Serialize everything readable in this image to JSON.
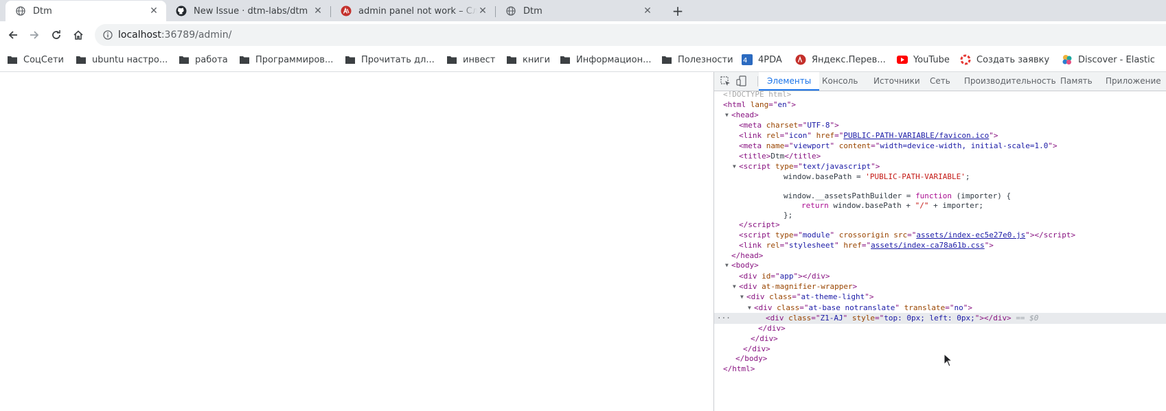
{
  "tabs": [
    {
      "title": "Dtm",
      "icon": "globe-icon",
      "active": true
    },
    {
      "title": "New Issue · dtm-labs/dtm",
      "icon": "github-icon",
      "active": false
    },
    {
      "title": "admin panel not work – Сл",
      "icon": "app-red-icon",
      "active": false
    },
    {
      "title": "Dtm",
      "icon": "globe-icon",
      "active": false
    }
  ],
  "toolbar": {
    "url_host": "localhost",
    "url_rest": ":36789/admin/"
  },
  "bookmarks": [
    {
      "label": "СоцСети",
      "icon": "folder-icon"
    },
    {
      "label": "ubuntu настро...",
      "icon": "folder-icon"
    },
    {
      "label": "работа",
      "icon": "folder-icon"
    },
    {
      "label": "Программиров...",
      "icon": "folder-icon"
    },
    {
      "label": "Прочитать дл...",
      "icon": "folder-icon"
    },
    {
      "label": "инвест",
      "icon": "folder-icon"
    },
    {
      "label": "книги",
      "icon": "folder-icon"
    },
    {
      "label": "Информацион...",
      "icon": "folder-icon"
    },
    {
      "label": "Полезности",
      "icon": "folder-icon"
    },
    {
      "label": "4PDA",
      "icon": "4pda-icon"
    },
    {
      "label": "Яндекс.Перев...",
      "icon": "yandex-translate-icon"
    },
    {
      "label": "YouTube",
      "icon": "youtube-icon"
    },
    {
      "label": "Создать заявку",
      "icon": "lifebuoy-icon"
    },
    {
      "label": "Discover - Elastic",
      "icon": "elastic-icon"
    }
  ],
  "devtools": {
    "tabs": [
      "Элементы",
      "Консоль",
      "Источники",
      "Сеть",
      "Производительность",
      "Память",
      "Приложение"
    ],
    "active_tab": "Элементы",
    "dom": {
      "doctype": "<!DOCTYPE html>",
      "html_open": {
        "tag": "<html",
        "attr": "lang",
        "val": "en"
      },
      "head_open": "<head>",
      "meta_charset": {
        "attr": "charset",
        "val": "UTF-8"
      },
      "link_icon": {
        "rel": "icon",
        "href": "PUBLIC-PATH-VARIABLE/favicon.ico"
      },
      "meta_viewport": {
        "name": "viewport",
        "content": "width=device-width, initial-scale=1.0"
      },
      "title_text": "Dtm",
      "script_type": "text/javascript",
      "js_line1_a": "window.basePath = ",
      "js_line1_str": "'PUBLIC-PATH-VARIABLE'",
      "js_line1_b": ";",
      "js_line2_a": "window.__assetsPathBuilder = ",
      "js_line2_kw": "function",
      "js_line2_b": " (importer) {",
      "js_line3_kw": "return",
      "js_line3_a": " window.basePath + ",
      "js_line3_str": "\"/\"",
      "js_line3_b": " + importer;",
      "js_line4": "};",
      "script_module": {
        "type": "module",
        "src": "assets/index-ec5e27e0.js"
      },
      "link_css": {
        "rel": "stylesheet",
        "href": "assets/index-ca78a61b.css"
      },
      "div_app_id": "app",
      "wrapper_attr": "at-magnifier-wrapper",
      "theme_class": "at-theme-light",
      "base_class": "at-base notranslate",
      "base_translate": "no",
      "selected_class": "Z1-AJ",
      "selected_style": "top: 0px; left: 0px;",
      "selected_marker": "== $0"
    }
  },
  "colors": {
    "tabstrip": "#dee1e6",
    "accent": "#1a73e8",
    "tag": "#881280",
    "attr": "#994500",
    "value": "#1a1aa6"
  }
}
